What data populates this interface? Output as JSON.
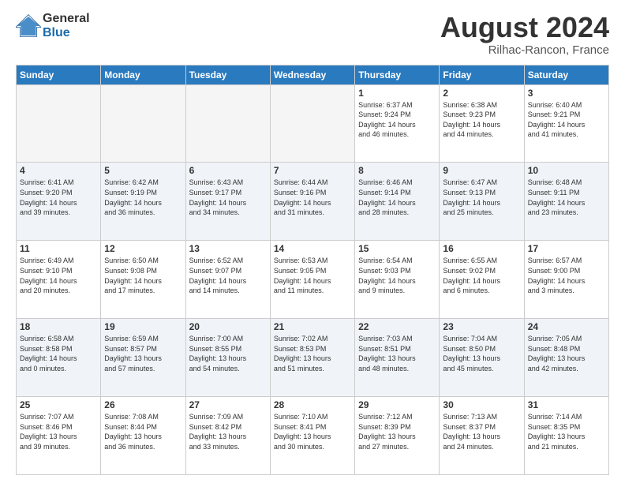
{
  "header": {
    "logo_general": "General",
    "logo_blue": "Blue",
    "month_title": "August 2024",
    "subtitle": "Rilhac-Rancon, France"
  },
  "days_of_week": [
    "Sunday",
    "Monday",
    "Tuesday",
    "Wednesday",
    "Thursday",
    "Friday",
    "Saturday"
  ],
  "weeks": [
    [
      {
        "day": "",
        "info": ""
      },
      {
        "day": "",
        "info": ""
      },
      {
        "day": "",
        "info": ""
      },
      {
        "day": "",
        "info": ""
      },
      {
        "day": "1",
        "info": "Sunrise: 6:37 AM\nSunset: 9:24 PM\nDaylight: 14 hours\nand 46 minutes."
      },
      {
        "day": "2",
        "info": "Sunrise: 6:38 AM\nSunset: 9:23 PM\nDaylight: 14 hours\nand 44 minutes."
      },
      {
        "day": "3",
        "info": "Sunrise: 6:40 AM\nSunset: 9:21 PM\nDaylight: 14 hours\nand 41 minutes."
      }
    ],
    [
      {
        "day": "4",
        "info": "Sunrise: 6:41 AM\nSunset: 9:20 PM\nDaylight: 14 hours\nand 39 minutes."
      },
      {
        "day": "5",
        "info": "Sunrise: 6:42 AM\nSunset: 9:19 PM\nDaylight: 14 hours\nand 36 minutes."
      },
      {
        "day": "6",
        "info": "Sunrise: 6:43 AM\nSunset: 9:17 PM\nDaylight: 14 hours\nand 34 minutes."
      },
      {
        "day": "7",
        "info": "Sunrise: 6:44 AM\nSunset: 9:16 PM\nDaylight: 14 hours\nand 31 minutes."
      },
      {
        "day": "8",
        "info": "Sunrise: 6:46 AM\nSunset: 9:14 PM\nDaylight: 14 hours\nand 28 minutes."
      },
      {
        "day": "9",
        "info": "Sunrise: 6:47 AM\nSunset: 9:13 PM\nDaylight: 14 hours\nand 25 minutes."
      },
      {
        "day": "10",
        "info": "Sunrise: 6:48 AM\nSunset: 9:11 PM\nDaylight: 14 hours\nand 23 minutes."
      }
    ],
    [
      {
        "day": "11",
        "info": "Sunrise: 6:49 AM\nSunset: 9:10 PM\nDaylight: 14 hours\nand 20 minutes."
      },
      {
        "day": "12",
        "info": "Sunrise: 6:50 AM\nSunset: 9:08 PM\nDaylight: 14 hours\nand 17 minutes."
      },
      {
        "day": "13",
        "info": "Sunrise: 6:52 AM\nSunset: 9:07 PM\nDaylight: 14 hours\nand 14 minutes."
      },
      {
        "day": "14",
        "info": "Sunrise: 6:53 AM\nSunset: 9:05 PM\nDaylight: 14 hours\nand 11 minutes."
      },
      {
        "day": "15",
        "info": "Sunrise: 6:54 AM\nSunset: 9:03 PM\nDaylight: 14 hours\nand 9 minutes."
      },
      {
        "day": "16",
        "info": "Sunrise: 6:55 AM\nSunset: 9:02 PM\nDaylight: 14 hours\nand 6 minutes."
      },
      {
        "day": "17",
        "info": "Sunrise: 6:57 AM\nSunset: 9:00 PM\nDaylight: 14 hours\nand 3 minutes."
      }
    ],
    [
      {
        "day": "18",
        "info": "Sunrise: 6:58 AM\nSunset: 8:58 PM\nDaylight: 14 hours\nand 0 minutes."
      },
      {
        "day": "19",
        "info": "Sunrise: 6:59 AM\nSunset: 8:57 PM\nDaylight: 13 hours\nand 57 minutes."
      },
      {
        "day": "20",
        "info": "Sunrise: 7:00 AM\nSunset: 8:55 PM\nDaylight: 13 hours\nand 54 minutes."
      },
      {
        "day": "21",
        "info": "Sunrise: 7:02 AM\nSunset: 8:53 PM\nDaylight: 13 hours\nand 51 minutes."
      },
      {
        "day": "22",
        "info": "Sunrise: 7:03 AM\nSunset: 8:51 PM\nDaylight: 13 hours\nand 48 minutes."
      },
      {
        "day": "23",
        "info": "Sunrise: 7:04 AM\nSunset: 8:50 PM\nDaylight: 13 hours\nand 45 minutes."
      },
      {
        "day": "24",
        "info": "Sunrise: 7:05 AM\nSunset: 8:48 PM\nDaylight: 13 hours\nand 42 minutes."
      }
    ],
    [
      {
        "day": "25",
        "info": "Sunrise: 7:07 AM\nSunset: 8:46 PM\nDaylight: 13 hours\nand 39 minutes."
      },
      {
        "day": "26",
        "info": "Sunrise: 7:08 AM\nSunset: 8:44 PM\nDaylight: 13 hours\nand 36 minutes."
      },
      {
        "day": "27",
        "info": "Sunrise: 7:09 AM\nSunset: 8:42 PM\nDaylight: 13 hours\nand 33 minutes."
      },
      {
        "day": "28",
        "info": "Sunrise: 7:10 AM\nSunset: 8:41 PM\nDaylight: 13 hours\nand 30 minutes."
      },
      {
        "day": "29",
        "info": "Sunrise: 7:12 AM\nSunset: 8:39 PM\nDaylight: 13 hours\nand 27 minutes."
      },
      {
        "day": "30",
        "info": "Sunrise: 7:13 AM\nSunset: 8:37 PM\nDaylight: 13 hours\nand 24 minutes."
      },
      {
        "day": "31",
        "info": "Sunrise: 7:14 AM\nSunset: 8:35 PM\nDaylight: 13 hours\nand 21 minutes."
      }
    ]
  ]
}
